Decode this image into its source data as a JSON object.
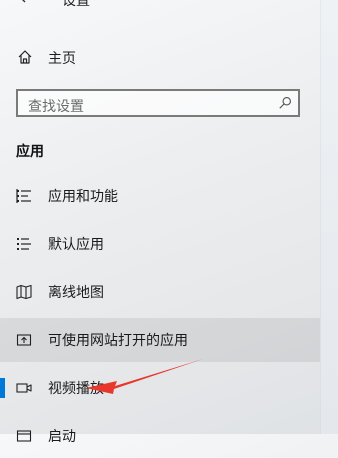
{
  "window": {
    "title": "设置"
  },
  "home": {
    "label": "主页"
  },
  "search": {
    "placeholder": "查找设置"
  },
  "section": {
    "heading": "应用"
  },
  "nav": {
    "items": [
      {
        "label": "应用和功能",
        "icon": "apps-list-icon"
      },
      {
        "label": "默认应用",
        "icon": "default-apps-icon"
      },
      {
        "label": "离线地图",
        "icon": "offline-map-icon"
      },
      {
        "label": "可使用网站打开的应用",
        "icon": "web-open-icon"
      },
      {
        "label": "视频播放",
        "icon": "video-icon"
      },
      {
        "label": "启动",
        "icon": "startup-icon"
      }
    ]
  },
  "colors": {
    "accent": "#0078d7",
    "annotation_arrow": "#e8372b"
  }
}
